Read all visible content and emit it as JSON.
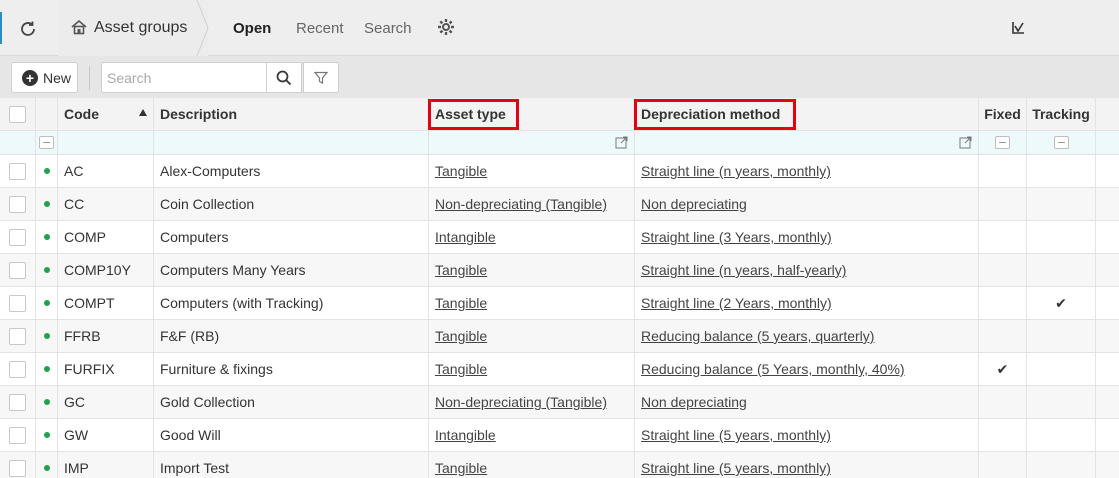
{
  "topbar": {
    "breadcrumb": "Asset groups",
    "tabs": [
      {
        "label": "Open",
        "active": true
      },
      {
        "label": "Recent",
        "active": false
      },
      {
        "label": "Search",
        "active": false
      }
    ]
  },
  "toolbar": {
    "new_label": "New",
    "search_placeholder": "Search"
  },
  "columns": {
    "code": "Code",
    "description": "Description",
    "asset_type": "Asset type",
    "depreciation_method": "Depreciation method",
    "fixed": "Fixed",
    "tracking": "Tracking"
  },
  "rows": [
    {
      "code": "AC",
      "description": "Alex-Computers",
      "asset_type": "Tangible",
      "depreciation_method": "Straight line (n years, monthly)",
      "fixed": "",
      "tracking": ""
    },
    {
      "code": "CC",
      "description": "Coin Collection",
      "asset_type": "Non-depreciating (Tangible)",
      "depreciation_method": "Non depreciating",
      "fixed": "",
      "tracking": ""
    },
    {
      "code": "COMP",
      "description": "Computers",
      "asset_type": "Intangible",
      "depreciation_method": "Straight line (3 Years, monthly)",
      "fixed": "",
      "tracking": ""
    },
    {
      "code": "COMP10Y",
      "description": "Computers Many Years",
      "asset_type": "Tangible",
      "depreciation_method": "Straight line (n years, half-yearly)",
      "fixed": "",
      "tracking": ""
    },
    {
      "code": "COMPT",
      "description": "Computers (with Tracking)",
      "asset_type": "Tangible",
      "depreciation_method": "Straight line (2 Years, monthly)",
      "fixed": "",
      "tracking": "✔"
    },
    {
      "code": "FFRB",
      "description": "F&F (RB)",
      "asset_type": "Tangible",
      "depreciation_method": "Reducing balance (5 years, quarterly)",
      "fixed": "",
      "tracking": ""
    },
    {
      "code": "FURFIX",
      "description": "Furniture & fixings",
      "asset_type": "Tangible",
      "depreciation_method": "Reducing balance (5 Years, monthly, 40%)",
      "fixed": "✔",
      "tracking": ""
    },
    {
      "code": "GC",
      "description": "Gold Collection",
      "asset_type": "Non-depreciating (Tangible)",
      "depreciation_method": "Non depreciating",
      "fixed": "",
      "tracking": ""
    },
    {
      "code": "GW",
      "description": "Good Will",
      "asset_type": "Intangible",
      "depreciation_method": "Straight line (5 years, monthly)",
      "fixed": "",
      "tracking": ""
    },
    {
      "code": "IMP",
      "description": "Import Test",
      "asset_type": "Tangible",
      "depreciation_method": "Straight line (5 years, monthly)",
      "fixed": "",
      "tracking": ""
    }
  ],
  "colors": {
    "status_active": "#1fa34a",
    "highlight_box": "#e60012",
    "filter_row_bg": "#eef9fc"
  }
}
